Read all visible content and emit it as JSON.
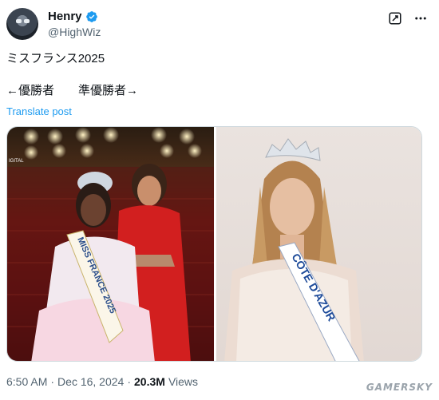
{
  "author": {
    "display_name": "Henry",
    "handle": "@HighWiz",
    "verified": true
  },
  "tweet": {
    "line1": "ミスフランス2025",
    "line2": "←優勝者　　準優勝者→",
    "translate_label": "Translate post"
  },
  "media": {
    "left_photo": {
      "overlay_text": "IGITAL",
      "sash_text": "MISS FRANCE 2025"
    },
    "right_photo": {
      "sash_text": "CÔTE D'AZUR"
    }
  },
  "meta": {
    "time": "6:50 AM",
    "separator": "·",
    "date": "Dec 16, 2024",
    "views_count": "20.3M",
    "views_label": "Views"
  },
  "watermark": "GAMERSKY",
  "colors": {
    "link": "#1d9bf0",
    "verified": "#1d9bf0",
    "muted": "#536471",
    "text": "#0f1419"
  },
  "icons": [
    "verified-badge-icon",
    "grok-icon",
    "more-icon"
  ]
}
